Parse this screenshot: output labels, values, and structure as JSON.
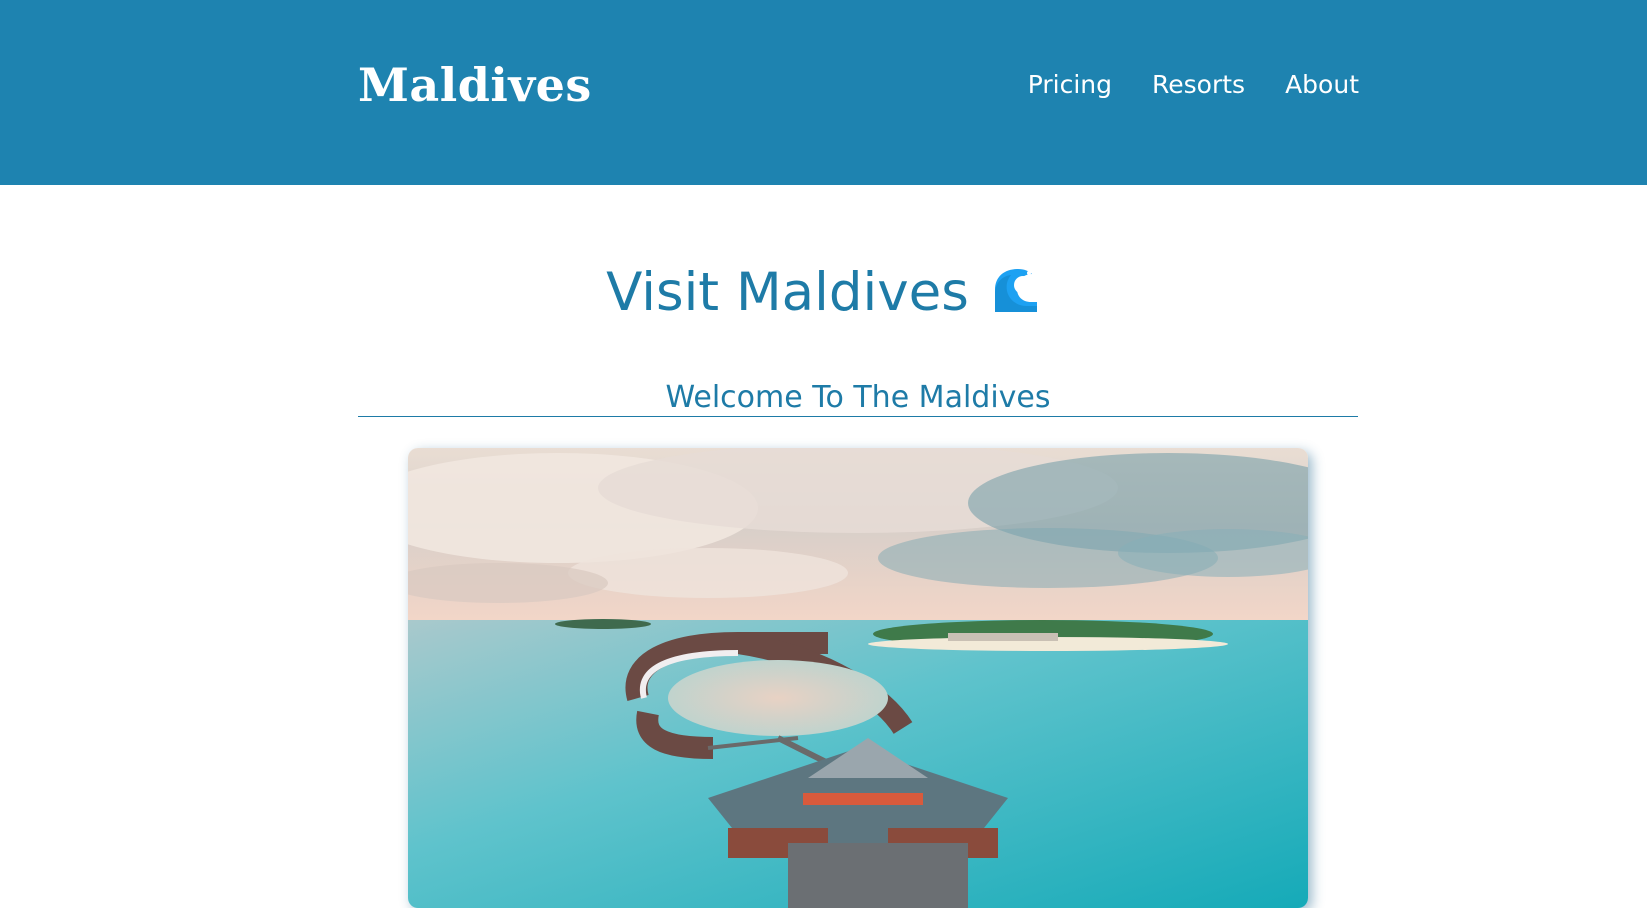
{
  "header": {
    "brand": "Maldives",
    "nav": [
      {
        "label": "Pricing"
      },
      {
        "label": "Resorts"
      },
      {
        "label": "About"
      }
    ],
    "bg_color": "#1e83b0"
  },
  "main": {
    "title": "Visit Maldives",
    "title_icon": "water-wave-icon",
    "section_heading": "Welcome To The Maldives",
    "accent_color": "#1e7ba7",
    "image": {
      "subject": "overwater-bungalows-resort-photo"
    }
  }
}
